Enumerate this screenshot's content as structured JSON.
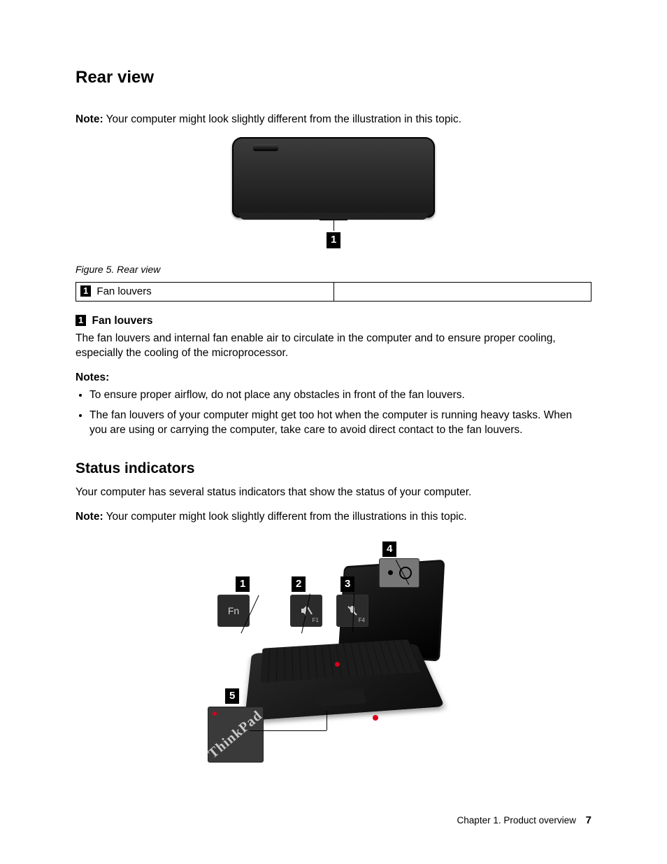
{
  "headings": {
    "rear_view": "Rear view",
    "status_indicators": "Status indicators"
  },
  "rear": {
    "note_label": "Note:",
    "note_text": " Your computer might look slightly different from the illustration in this topic.",
    "callout_number": "1",
    "figure_caption": "Figure 5.  Rear view",
    "legend": {
      "cell1_number": "1",
      "cell1_text": " Fan louvers",
      "cell2_text": ""
    },
    "fan_louvers": {
      "number": "1",
      "title": " Fan louvers",
      "desc": "The fan louvers and internal fan enable air to circulate in the computer and to ensure proper cooling, especially the cooling of the microprocessor."
    },
    "notes_heading": "Notes:",
    "notes": [
      "To ensure proper airflow, do not place any obstacles in front of the fan louvers.",
      "The fan louvers of your computer might get too hot when the computer is running heavy tasks. When you are using or carrying the computer, take care to avoid direct contact to the fan louvers."
    ]
  },
  "status": {
    "intro": "Your computer has several status indicators that show the status of your computer.",
    "note_label": "Note:",
    "note_text": " Your computer might look slightly different from the illustrations in this topic.",
    "callouts": {
      "c1": "1",
      "c2": "2",
      "c3": "3",
      "c4": "4",
      "c5": "5"
    },
    "details": {
      "fn_label": "Fn",
      "mute_sub": "F1",
      "micmute_sub": "F4",
      "logo_text": "ThinkPad"
    }
  },
  "footer": {
    "chapter": "Chapter 1.  Product overview",
    "page": "7"
  }
}
